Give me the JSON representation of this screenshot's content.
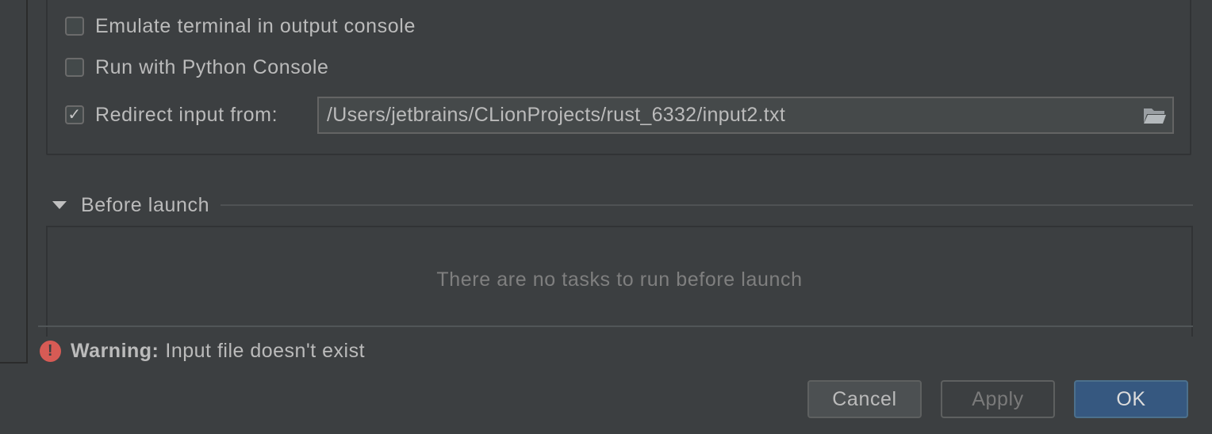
{
  "options": {
    "emulate_terminal": {
      "label": "Emulate terminal in output console",
      "checked": false
    },
    "python_console": {
      "label": "Run with Python Console",
      "checked": false
    },
    "redirect_input": {
      "label": "Redirect input from:",
      "checked": true,
      "check_glyph": "✓",
      "path_value": "/Users/jetbrains/CLionProjects/rust_6332/input2.txt"
    }
  },
  "before_launch": {
    "title": "Before launch",
    "empty_text": "There are no tasks to run before launch"
  },
  "warning": {
    "icon_glyph": "!",
    "label": "Warning:",
    "message": "Input file doesn't exist"
  },
  "buttons": {
    "cancel": "Cancel",
    "apply": "Apply",
    "ok": "OK"
  },
  "icons": {
    "folder": "folder-icon",
    "collapse": "triangle-down-icon",
    "warning": "error-icon",
    "check": "checkmark-icon"
  },
  "colors": {
    "background": "#3c3f41",
    "ok_button": "#365880",
    "warning": "#d75b55"
  }
}
